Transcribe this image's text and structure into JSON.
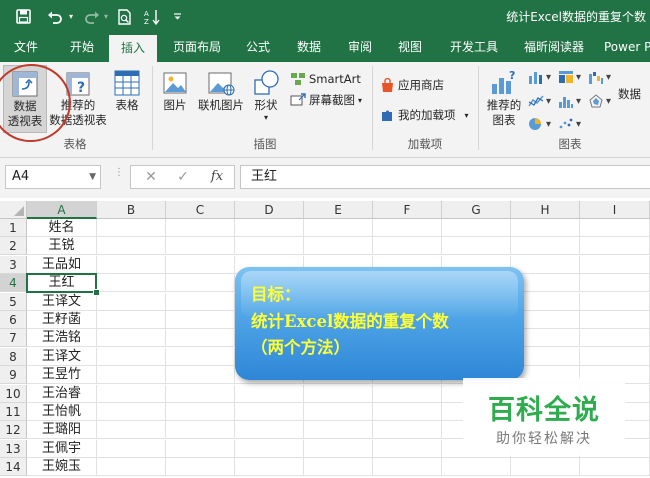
{
  "window": {
    "doc_title": "统计Excel数据的重复个数"
  },
  "qat": {
    "save_icon": "save-icon",
    "undo_icon": "undo-icon",
    "redo_icon": "redo-icon",
    "print_preview_icon": "print-preview-icon",
    "sort_icon": "sort-ascending-icon",
    "customize_icon": "customize-qat-icon"
  },
  "tabs": [
    "文件",
    "开始",
    "插入",
    "页面布局",
    "公式",
    "数据",
    "审阅",
    "视图",
    "开发工具",
    "福昕阅读器",
    "Power P"
  ],
  "active_tab": "插入",
  "ribbon": {
    "tables": {
      "pivot_line1": "数据",
      "pivot_line2": "透视表",
      "rec_pivot_line1": "推荐的",
      "rec_pivot_line2": "数据透视表",
      "table": "表格",
      "group_label": "表格"
    },
    "illustrations": {
      "pictures": "图片",
      "online_pictures": "联机图片",
      "shapes": "形状",
      "smartart": "SmartArt",
      "screenshot": "屏幕截图",
      "group_label": "插图"
    },
    "addins": {
      "store": "应用商店",
      "my_addins": "我的加载项",
      "group_label": "加载项"
    },
    "charts": {
      "rec_charts_line1": "推荐的",
      "rec_charts_line2": "图表",
      "pivot_chart": "数据",
      "group_label": "图表"
    },
    "accent_color": "#217346"
  },
  "formula_bar": {
    "name_box": "A4",
    "cancel_glyph": "✕",
    "enter_glyph": "✓",
    "fx_label": "fx",
    "value": "王红"
  },
  "sheet": {
    "columns": [
      "A",
      "B",
      "C",
      "D",
      "E",
      "F",
      "G",
      "H",
      "I"
    ],
    "rows": [
      "1",
      "2",
      "3",
      "4",
      "5",
      "6",
      "7",
      "8",
      "9",
      "10",
      "11",
      "12",
      "13",
      "14"
    ],
    "col_a": [
      "姓名",
      "王锐",
      "王品如",
      "王红",
      "王译文",
      "王籽菡",
      "王浩铭",
      "王译文",
      "王昱竹",
      "王治睿",
      "王怡帆",
      "王璐阳",
      "王佩宇",
      "王婉玉"
    ],
    "active_cell": "A4",
    "active_row_index": 3
  },
  "goal_box": {
    "line1": "目标：",
    "line2": "统计Excel数据的重复个数",
    "line3": "（两个方法）"
  },
  "watermark": {
    "title": "百科全说",
    "subtitle": "助你轻松解决"
  }
}
